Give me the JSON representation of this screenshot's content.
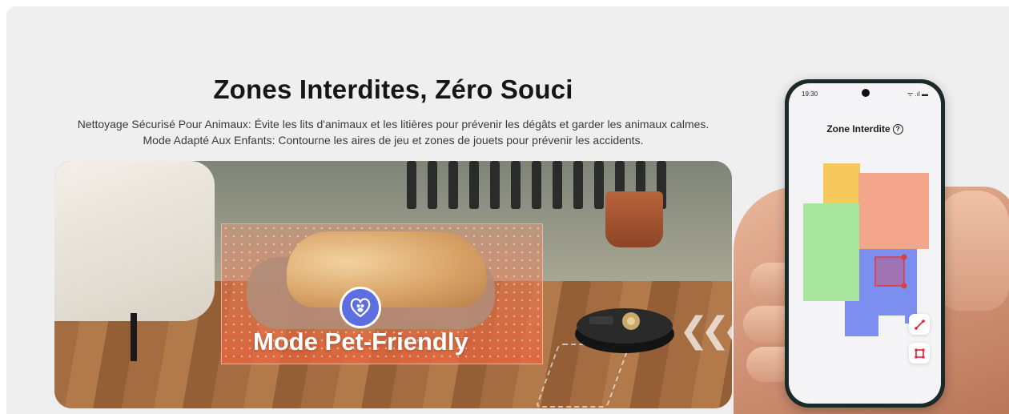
{
  "banner": {
    "headline": "Zones Interdites, Zéro Souci",
    "line1": "Nettoyage Sécurisé Pour Animaux: Évite les lits d'animaux et les litières pour prévenir les dégâts et garder les animaux calmes.",
    "line2": "Mode Adapté Aux Enfants: Contourne les aires de jeu et zones de jouets pour prévenir les accidents.",
    "pet_mode_label": "Mode Pet-Friendly"
  },
  "phone": {
    "time": "19:30",
    "status_icons": "ᯤ .ıl ▬",
    "title": "Zone Interdite",
    "help_icon": "?",
    "colors": {
      "yellow_room": "#f7c95c",
      "orange_room": "#f3a68c",
      "green_room": "#a8e6a0",
      "blue_room": "#7c8ff0",
      "no_go_zone": "#e23b3b",
      "tool_accent": "#e0243b"
    }
  }
}
